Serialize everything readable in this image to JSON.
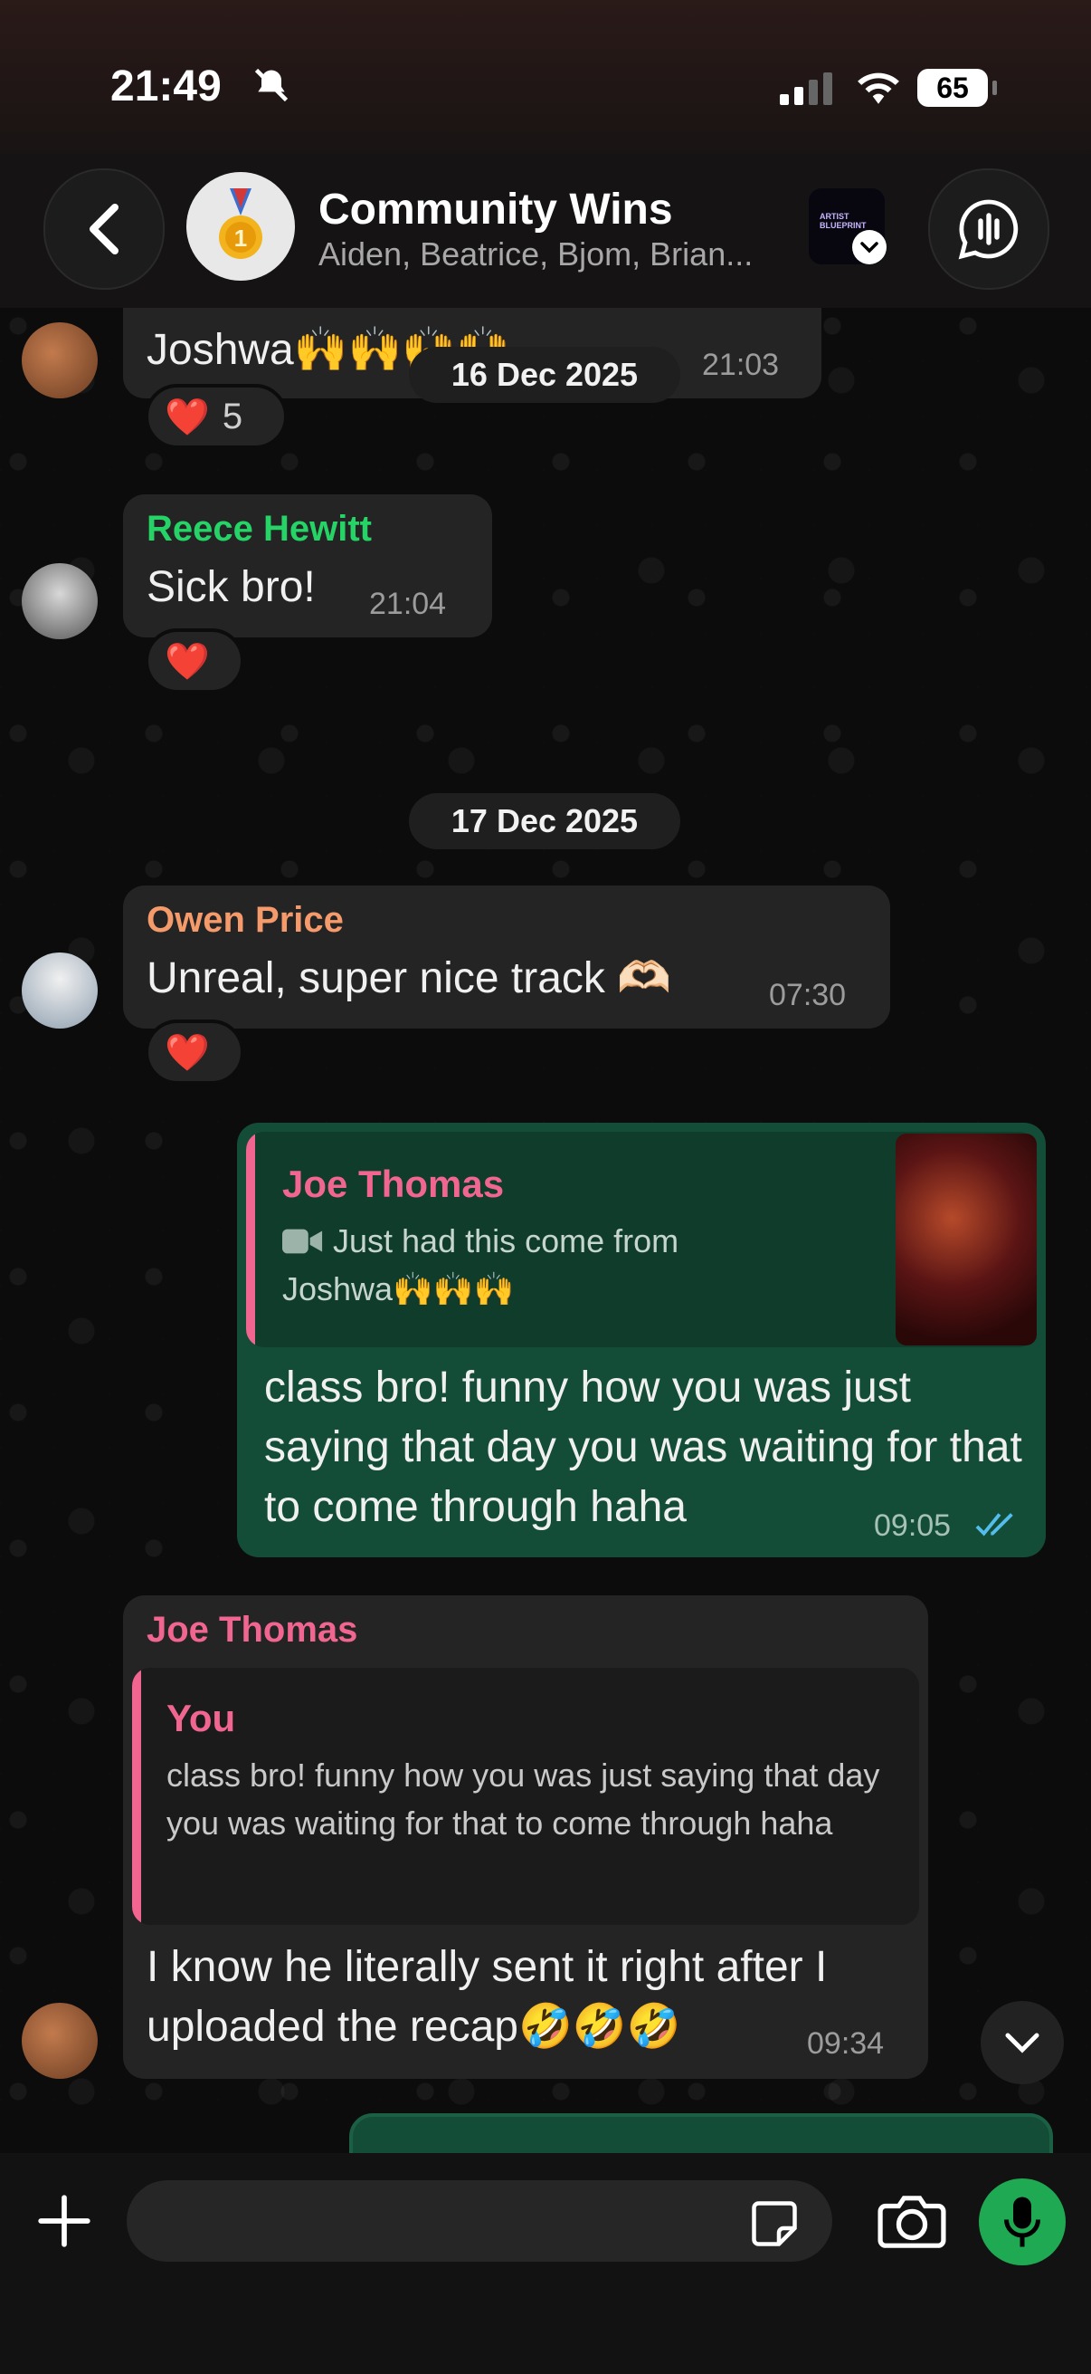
{
  "status_bar": {
    "time": "21:49",
    "battery": "65"
  },
  "header": {
    "title": "Community Wins",
    "members": "Aiden, Beatrice, Bjom, Brian...",
    "logo_text": "ARTIST BLUEPRINT"
  },
  "messages": {
    "m1": {
      "text": "Joshwa🙌🙌🙌🙌",
      "time": "21:03",
      "reaction": "❤️",
      "reaction_count": "5"
    },
    "date1": "16 Dec 2025",
    "m2": {
      "sender": "Reece Hewitt",
      "text": "Sick bro!",
      "time": "21:04",
      "reaction": "❤️"
    },
    "date2": "17 Dec 2025",
    "m3": {
      "sender": "Owen Price",
      "text": "Unreal, super nice track 🫶🏻",
      "time": "07:30",
      "reaction": "❤️"
    },
    "m4": {
      "quote_name": "Joe Thomas",
      "quote_text": "Just had this come from Joshwa🙌🙌🙌",
      "text": "class bro! funny how you was just saying that day you was waiting for that to come through haha",
      "time": "09:05"
    },
    "m5": {
      "sender": "Joe Thomas",
      "quote_name": "You",
      "quote_text": "class bro! funny how you was just saying that day you was waiting for that to come through haha",
      "text": "I know he literally sent it right after I uploaded the recap🤣🤣🤣",
      "time": "09:34"
    }
  },
  "colors": {
    "accent_green": "#1ea952",
    "outgoing_bubble": "#134d37",
    "incoming_bubble": "#242424",
    "sender_green": "#25d366",
    "sender_orange": "#f59a6b",
    "sender_pink": "#f06690",
    "read_ticks": "#53bdeb"
  },
  "composer": {
    "placeholder": ""
  }
}
